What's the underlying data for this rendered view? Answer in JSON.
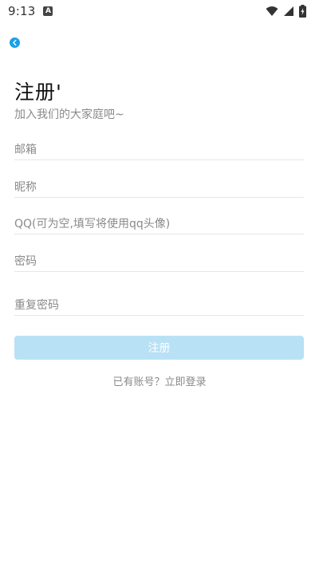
{
  "status_bar": {
    "time": "9:13",
    "notif_label": "A"
  },
  "header": {
    "back_icon": "chevron-left-icon",
    "title": "注册'",
    "subtitle": "加入我们的大家庭吧~"
  },
  "form": {
    "email_placeholder": "邮箱",
    "nickname_placeholder": "昵称",
    "qq_placeholder": "QQ(可为空,填写将使用qq头像)",
    "password_placeholder": "密码",
    "confirm_password_placeholder": "重复密码",
    "register_label": "注册",
    "login_link": "已有账号？立即登录"
  },
  "colors": {
    "accent": "#1aa0e6",
    "button_disabled": "#b8e1f5",
    "placeholder": "#8a8a8a",
    "divider": "#e6e6e6"
  }
}
